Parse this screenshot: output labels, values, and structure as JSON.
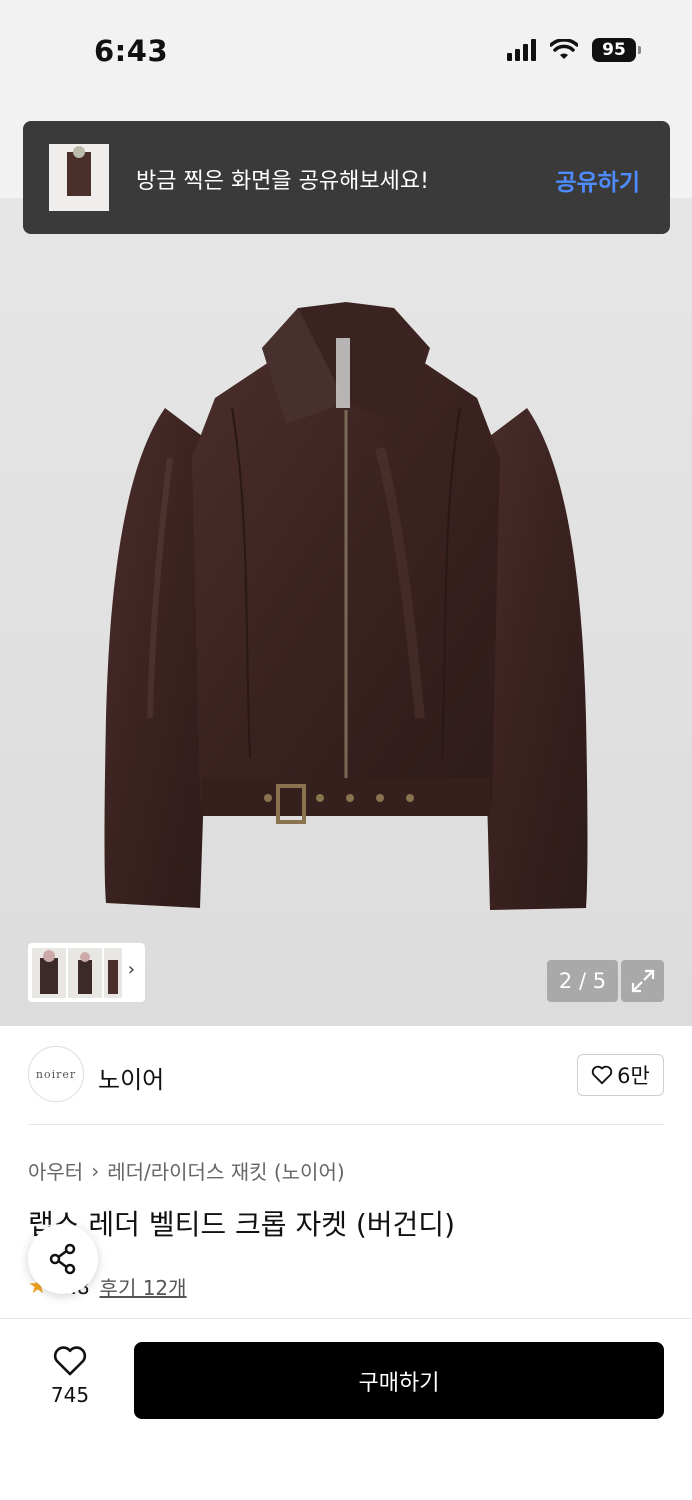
{
  "status_bar": {
    "time": "6:43",
    "battery": "95",
    "wifi_icon": "wifi-icon",
    "signal_icon": "cellular-signal-icon"
  },
  "toast": {
    "message": "방금 찍은 화면을 공유해보세요!",
    "action": "공유하기",
    "action_color": "#4d8bff"
  },
  "gallery": {
    "counter": "2 / 5",
    "thumbnail_arrow": "›",
    "expand_icon": "expand-icon"
  },
  "brand": {
    "logo_text": "noirer",
    "name": "노이어",
    "likes": "6만"
  },
  "breadcrumb": {
    "category": "아우터",
    "separator": "›",
    "subcategory": "레더/라이더스 재킷 (노이어)"
  },
  "product": {
    "title": "랩스 레더 벨티드 크롭 자켓 (버건디)",
    "rating": "4.8",
    "reviews": "후기 12개"
  },
  "bottom_bar": {
    "wish_count": "745",
    "buy_label": "구매하기"
  },
  "colors": {
    "jacket": "#3f2624",
    "background": "#e0e0e0",
    "buy_button": "#000000",
    "star": "#f5a623"
  }
}
